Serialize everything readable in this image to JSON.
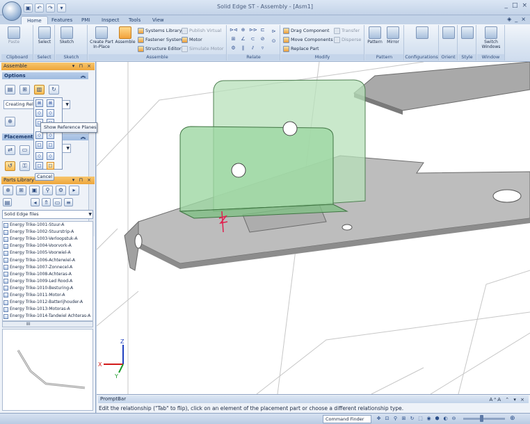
{
  "window": {
    "title": "Solid Edge ST - Assembly - [Asm1]",
    "controls": [
      "_",
      "□",
      "×"
    ]
  },
  "qat": {
    "save_icon": "save-icon",
    "undo_icon": "undo-icon",
    "redo_icon": "redo-icon"
  },
  "tabs": [
    "Home",
    "Features",
    "PMI",
    "Inspect",
    "Tools",
    "View"
  ],
  "active_tab": "Home",
  "tab_right": [
    "_",
    "×"
  ],
  "ribbon": {
    "clipboard": {
      "label": "Clipboard",
      "paste": "Paste"
    },
    "select": {
      "label": "Select",
      "select": "Select"
    },
    "sketch": {
      "label": "Sketch",
      "sketch": "Sketch"
    },
    "assemble": {
      "label": "Assemble",
      "create_part": "Create Part In-Place",
      "assemble": "Assemble",
      "systems_library": "Systems Library",
      "fastener_system": "Fastener System",
      "structure_editor": "Structure Editor",
      "publish_virtual": "Publish Virtual",
      "motor": "Motor",
      "simulate_motor": "Simulate Motor"
    },
    "relate": {
      "label": "Relate"
    },
    "modify": {
      "label": "Modify",
      "drag_component": "Drag Component",
      "move_components": "Move Components",
      "replace_part": "Replace Part",
      "transfer": "Transfer",
      "disperse": "Disperse"
    },
    "pattern": {
      "label": "Pattern",
      "pattern": "Pattern",
      "mirror": "Mirror"
    },
    "configurations": {
      "label": "Configurations"
    },
    "orient": {
      "label": "Orient"
    },
    "style": {
      "label": "Style"
    },
    "window": {
      "label": "Window",
      "switch_windows": "Switch Windows"
    }
  },
  "left_pane": {
    "title": "Assemble",
    "options_label": "Options",
    "relation_combo": "Creating Relat",
    "tooltip": "Show Reference Planes",
    "placement_label": "Placement",
    "cancel": "Cancel",
    "library_title": "Parts Library",
    "folder": "Solid Edge files",
    "files": [
      "Energy Trike-1001-Stuur-A",
      "Energy Trike-1002-Stuurstrip-A",
      "Energy Trike-1003-Verloopstuk-A",
      "Energy Trike-1004-Voorvork-A",
      "Energy Trike-1005-Voorwiel-A",
      "Energy Trike-1006-Achterwiel-A",
      "Energy Trike-1007-Zonnecel-A",
      "Energy Trike-1008-Achteras-A",
      "Energy Trike-1009-Led Rood-A",
      "Energy Trike-1010-Besturing-A",
      "Energy Trike-1011-Motor-A",
      "Energy Trike-1012-Batterijhouder-A",
      "Energy Trike-1013-Motoras-A",
      "Energy Trike-1014-Tandwiel Achteras-A"
    ],
    "hscroll_label": "III"
  },
  "triad": {
    "x": "X",
    "y": "Y",
    "z": "Z"
  },
  "prompt": {
    "title": "PromptBar",
    "text": "Edit the relationship (\"Tab\" to flip), click on an element of the placement part or choose a different relationship type."
  },
  "status": {
    "command_finder": "Command Finder"
  },
  "colors": {
    "accent": "#f0a63c",
    "ribbon": "#dae5f2",
    "part_green": "#9ed7a2",
    "part_grey": "#9a9a9a"
  }
}
